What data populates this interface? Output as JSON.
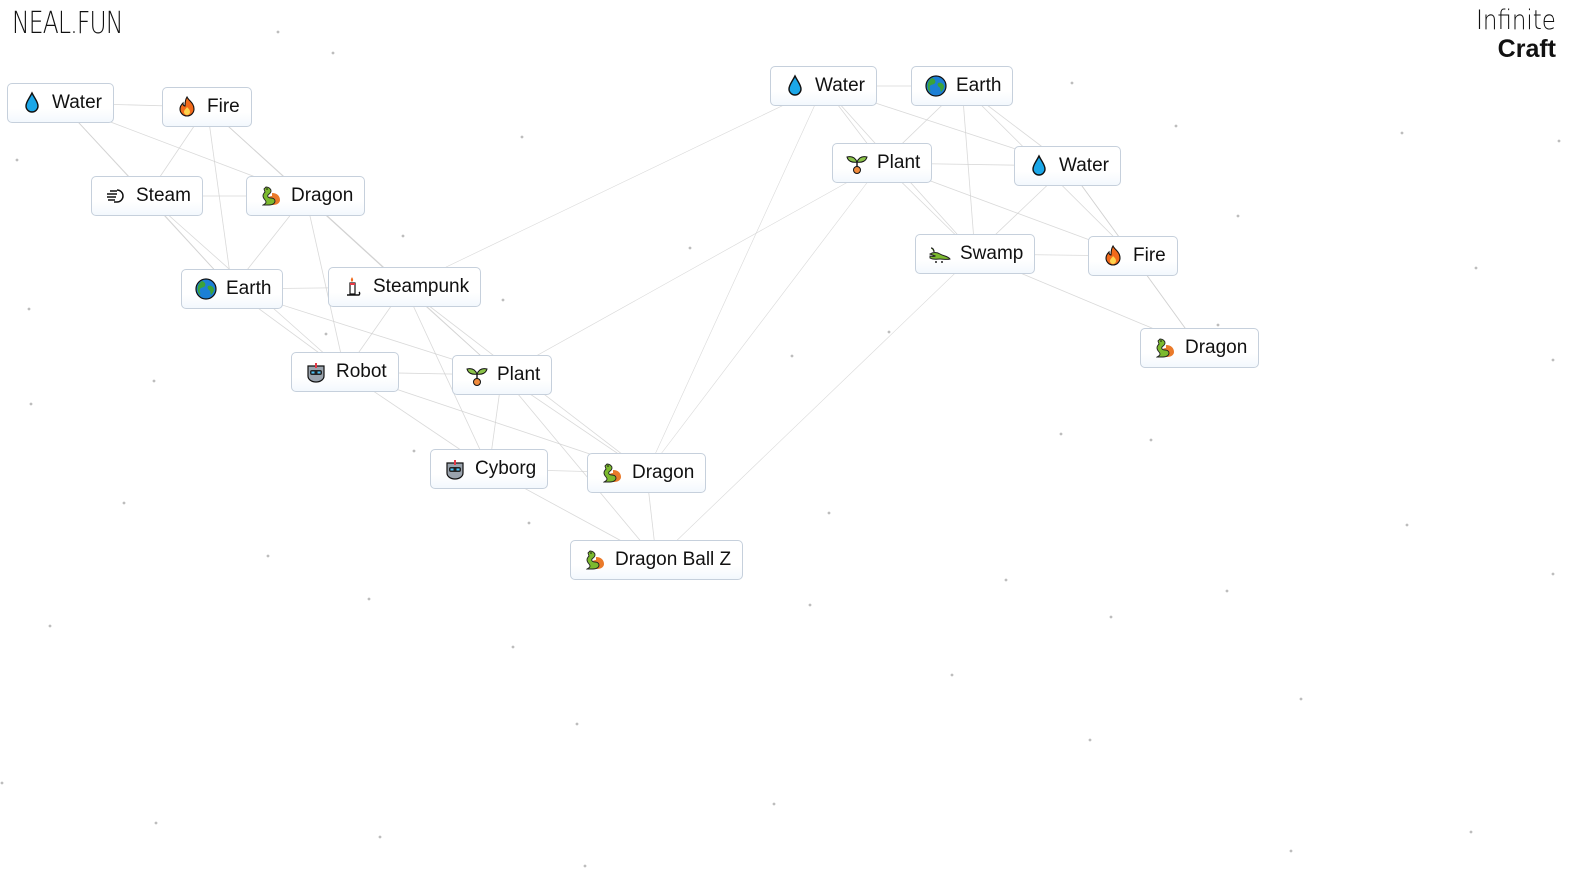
{
  "header": {
    "logo": "NEAL.FUN",
    "brand_line1": "Infinite",
    "brand_line2": "Craft"
  },
  "colors": {
    "tile_border": "#c6d0dc",
    "line": "#cfcfcf",
    "dot": "#bdbdbd"
  },
  "elements": [
    {
      "label": "Water",
      "icon": "water-drop-icon"
    },
    {
      "label": "Fire",
      "icon": "fire-icon"
    },
    {
      "label": "Steam",
      "icon": "steam-icon"
    },
    {
      "label": "Dragon",
      "icon": "dragon-icon"
    },
    {
      "label": "Earth",
      "icon": "earth-globe-icon"
    },
    {
      "label": "Steampunk",
      "icon": "candle-icon"
    },
    {
      "label": "Robot",
      "icon": "robot-icon"
    },
    {
      "label": "Plant",
      "icon": "seedling-icon"
    },
    {
      "label": "Cyborg",
      "icon": "robot-icon"
    },
    {
      "label": "Dragon",
      "icon": "dragon-icon"
    },
    {
      "label": "Dragon Ball Z",
      "icon": "dragon-icon"
    },
    {
      "label": "Water",
      "icon": "water-drop-icon"
    },
    {
      "label": "Earth",
      "icon": "earth-globe-icon"
    },
    {
      "label": "Plant",
      "icon": "seedling-icon"
    },
    {
      "label": "Water",
      "icon": "water-drop-icon"
    },
    {
      "label": "Swamp",
      "icon": "crocodile-icon"
    },
    {
      "label": "Fire",
      "icon": "fire-icon"
    },
    {
      "label": "Dragon",
      "icon": "dragon-icon"
    }
  ]
}
